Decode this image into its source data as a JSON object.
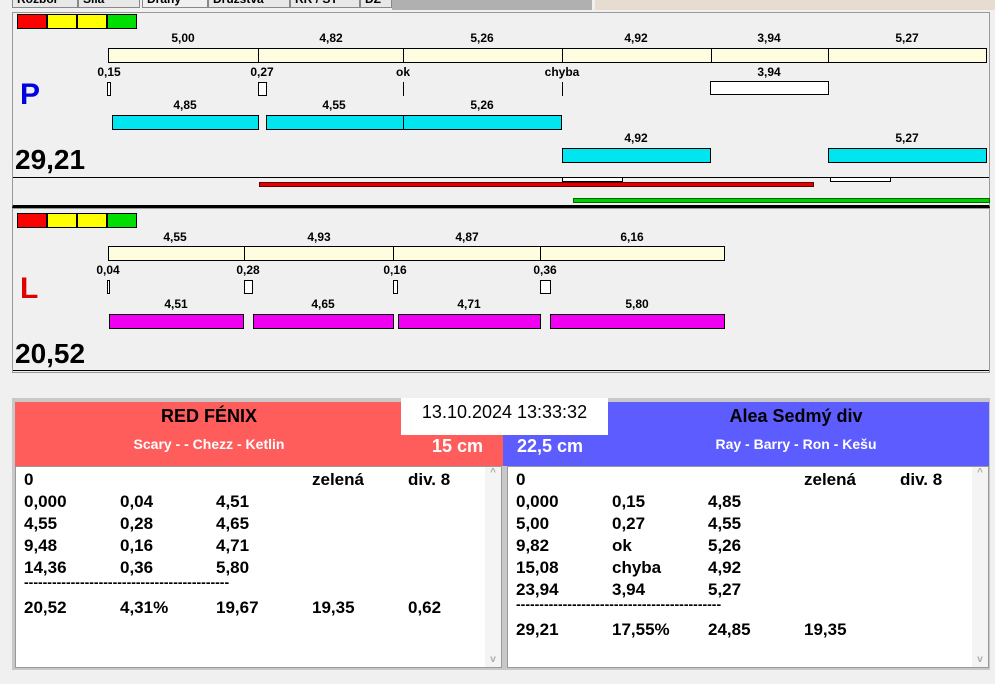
{
  "tabs": [
    "Rozbor",
    "Síla",
    "Dráhy",
    "Družstva",
    "RR / ST",
    "DZ"
  ],
  "colors": {
    "red": "#ff0000",
    "yellow": "#ffff00",
    "green": "#00d000",
    "team_left": "#ff5c5c",
    "team_right": "#5c5cff"
  },
  "p": {
    "letter": "P",
    "score": "29,21",
    "top_labels": [
      "5,00",
      "4,82",
      "5,26",
      "4,92",
      "3,94",
      "5,27"
    ],
    "mid_labels": [
      "0,15",
      "0,27",
      "ok",
      "chyba",
      "3,94"
    ],
    "cyan1_labels": [
      "4,85",
      "4,55",
      "5,26"
    ],
    "cyan2_labels": [
      "4,92",
      "5,27"
    ]
  },
  "l": {
    "letter": "L",
    "score": "20,52",
    "top_labels": [
      "4,55",
      "4,93",
      "4,87",
      "6,16"
    ],
    "mid_labels": [
      "0,04",
      "0,28",
      "0,16",
      "0,36"
    ],
    "magenta_labels": [
      "4,51",
      "4,65",
      "4,71",
      "5,80"
    ]
  },
  "datetime": "13.10.2024 13:33:32",
  "left_team": {
    "name": "RED FÉNIX",
    "players": "Scary -  - Chezz - Ketlin",
    "distance": "15 cm",
    "header": [
      "0",
      "zelená",
      "div. 8"
    ],
    "rows": [
      [
        "0,000",
        "0,04",
        "4,51"
      ],
      [
        "4,55",
        "0,28",
        "4,65"
      ],
      [
        "9,48",
        "0,16",
        "4,71"
      ],
      [
        "14,36",
        "0,36",
        "5,80"
      ]
    ],
    "separator": "--------------------------------------------",
    "total": [
      "20,52",
      "4,31%",
      "19,67",
      "19,35",
      "0,62"
    ]
  },
  "right_team": {
    "name": "Alea Sedmý div",
    "players": "Ray - Barry - Ron - Kešu",
    "distance": "22,5 cm",
    "header": [
      "0",
      "zelená",
      "div. 8"
    ],
    "rows": [
      [
        "0,000",
        "0,15",
        "4,85"
      ],
      [
        "5,00",
        "0,27",
        "4,55"
      ],
      [
        "9,82",
        "ok",
        "5,26"
      ],
      [
        "15,08",
        "chyba",
        "4,92"
      ],
      [
        "23,94",
        "3,94",
        "5,27"
      ]
    ],
    "separator": "--------------------------------------------",
    "total": [
      "29,21",
      "17,55%",
      "24,85",
      "19,35"
    ]
  }
}
